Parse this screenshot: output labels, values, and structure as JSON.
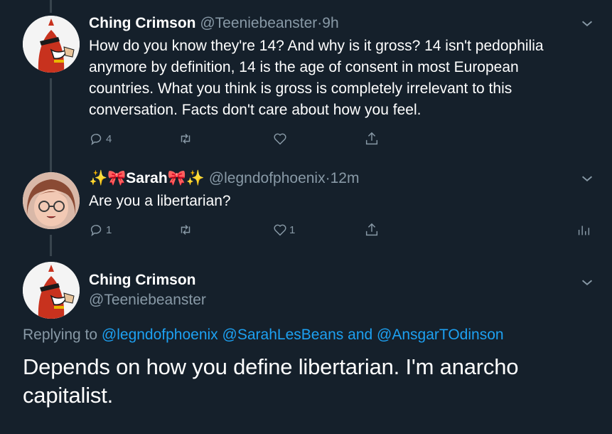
{
  "tweets": [
    {
      "name": "Ching Crimson",
      "handle": "@Teeniebeanster",
      "time": "9h",
      "text": "How do you know they're 14? And why is it gross? 14 isn't pedophilia anymore by definition, 14 is the age of consent in most European countries. What you think is gross is completely irrelevant to this conversation. Facts don't care about how you feel.",
      "reply_count": "4",
      "retweet_count": "",
      "like_count": ""
    },
    {
      "name": "✨🎀Sarah🎀✨",
      "handle": "@legndofphoenix",
      "time": "12m",
      "text": "Are you a libertarian?",
      "reply_count": "1",
      "retweet_count": "",
      "like_count": "1"
    }
  ],
  "focused": {
    "name": "Ching Crimson",
    "handle": "@Teeniebeanster",
    "replying_prefix": "Replying to",
    "mentions": [
      "@legndofphoenix",
      "@SarahLesBeans",
      "and",
      "@AnsgarTOdinson"
    ],
    "text": "Depends on how you define libertarian. I'm anarcho capitalist."
  },
  "colors": {
    "background": "#15202b",
    "secondary_text": "#8899a6",
    "link": "#1da1f2",
    "thread_line": "#38444d"
  },
  "icons": [
    "reply-icon",
    "retweet-icon",
    "like-icon",
    "share-icon",
    "analytics-icon",
    "chevron-down-icon"
  ]
}
